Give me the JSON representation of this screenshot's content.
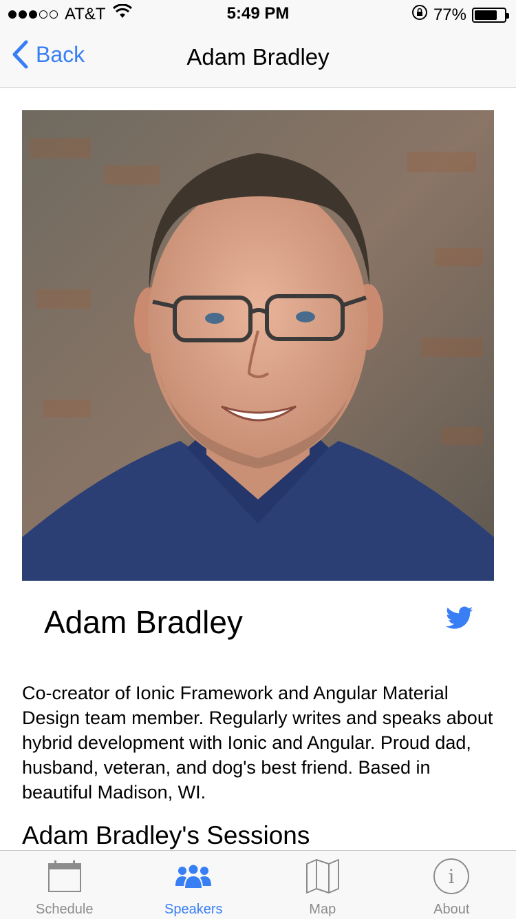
{
  "status_bar": {
    "carrier": "AT&T",
    "time": "5:49 PM",
    "battery_percent": "77%",
    "battery_level": 0.77
  },
  "nav": {
    "back_label": "Back",
    "title": "Adam Bradley"
  },
  "speaker": {
    "name": "Adam Bradley",
    "bio": "Co-creator of Ionic Framework and Angular Material Design team member. Regularly writes and speaks about hybrid development with Ionic and Angular. Proud dad, husband, veteran, and dog's best friend. Based in beautiful Madison, WI.",
    "sessions_heading": "Adam Bradley's Sessions"
  },
  "tabs": [
    {
      "label": "Schedule",
      "icon": "calendar-icon",
      "active": false
    },
    {
      "label": "Speakers",
      "icon": "people-icon",
      "active": true
    },
    {
      "label": "Map",
      "icon": "map-icon",
      "active": false
    },
    {
      "label": "About",
      "icon": "info-icon",
      "active": false
    }
  ],
  "colors": {
    "accent": "#387ef5",
    "twitter": "#1da1f2",
    "inactive": "#8c8c8c"
  }
}
